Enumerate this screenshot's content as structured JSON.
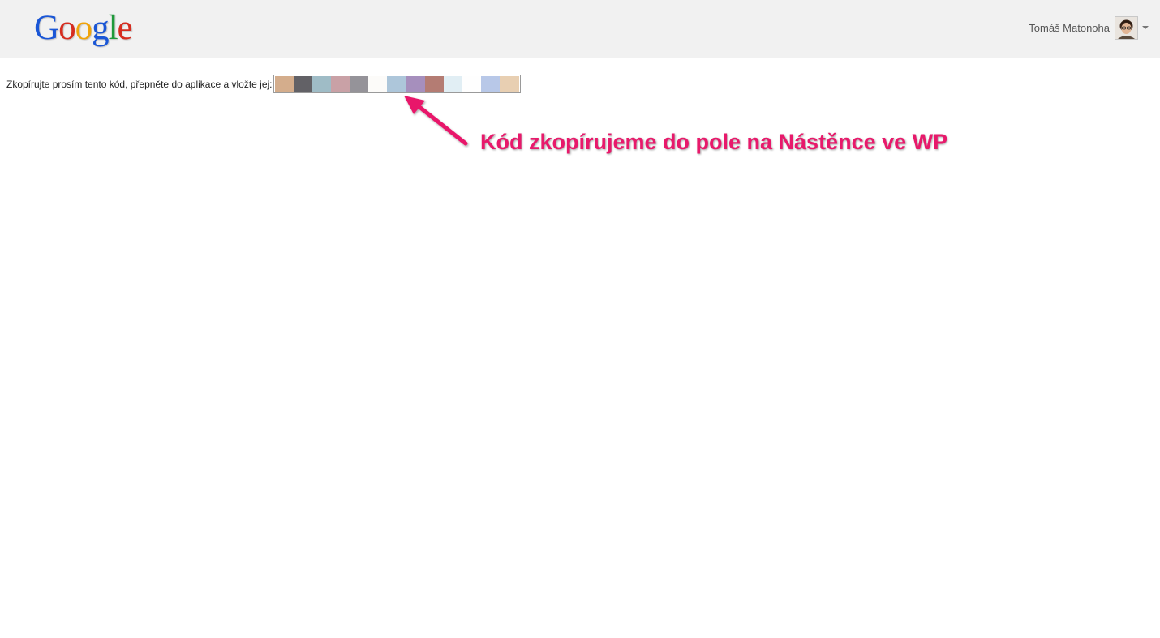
{
  "header": {
    "logo_letters": [
      {
        "ch": "G",
        "color": "#1a56d6"
      },
      {
        "ch": "o",
        "color": "#d62d20"
      },
      {
        "ch": "o",
        "color": "#f0a30a"
      },
      {
        "ch": "g",
        "color": "#1a56d6"
      },
      {
        "ch": "l",
        "color": "#1e9a3a"
      },
      {
        "ch": "e",
        "color": "#d62d20"
      }
    ],
    "account_name": "Tomáš Matonoha",
    "avatar_icon": "user-photo-icon",
    "dropdown_icon": "caret-down-icon"
  },
  "main": {
    "prompt": "Zkopírujte prosím tento kód, přepněte do aplikace a vložte jej:",
    "code_blocks": [
      "#d4ad8c",
      "#626166",
      "#9fbcc6",
      "#c9a1a6",
      "#959399",
      "#fcfbf9",
      "#adc6da",
      "#a68fbd",
      "#b47c73",
      "#e1eef4",
      "#fefefe",
      "#b8c8e8",
      "#e8cfb2"
    ]
  },
  "annotation": {
    "text": "Kód zkopírujeme do pole na Nástěnce ve WP",
    "color": "#e8196b"
  }
}
